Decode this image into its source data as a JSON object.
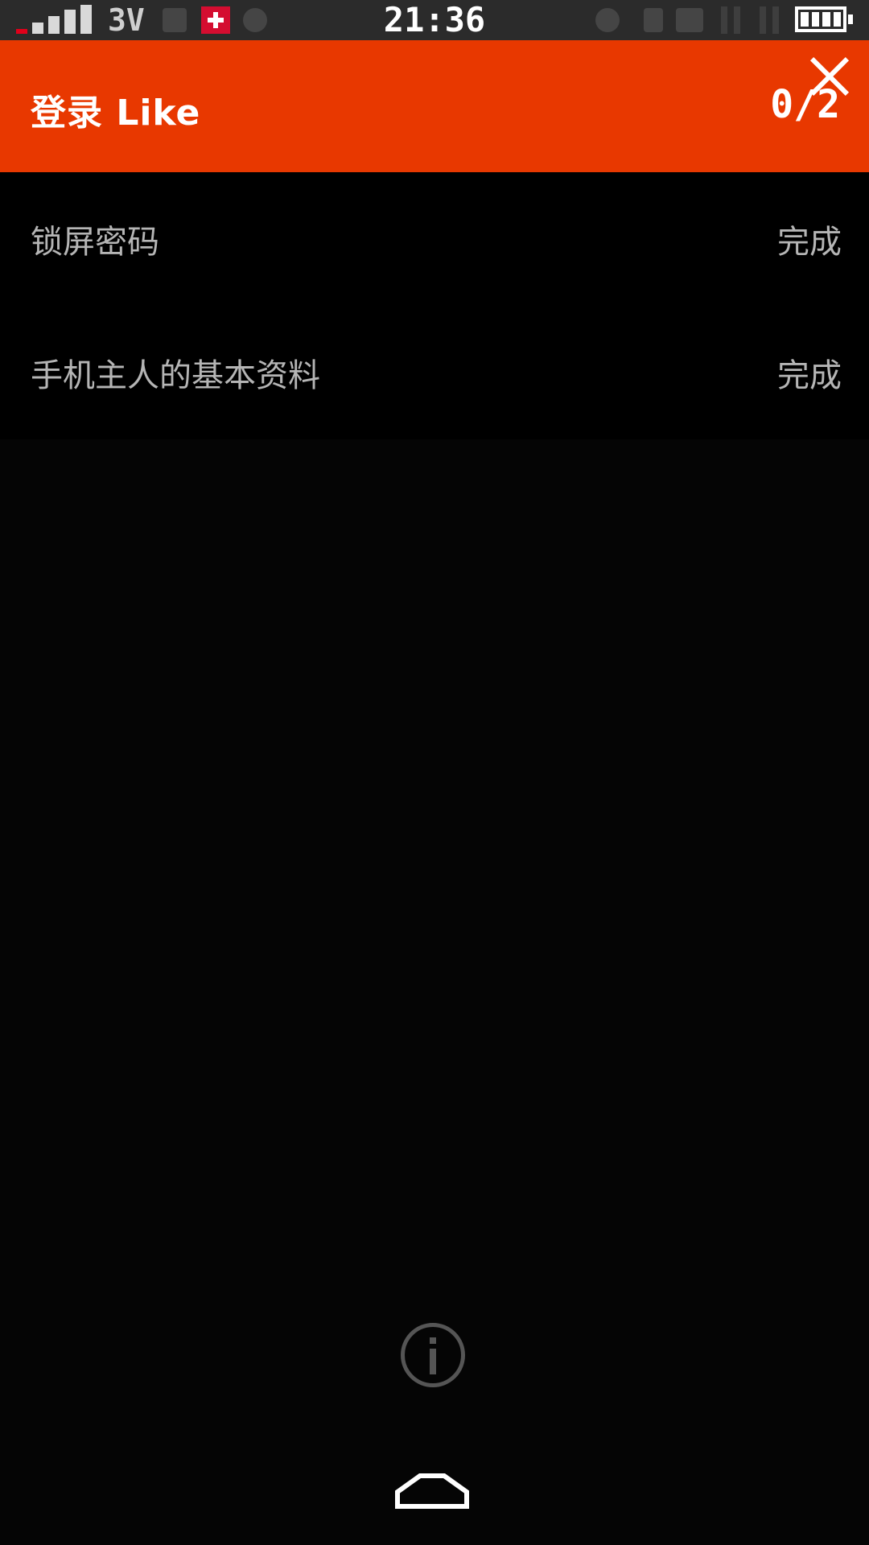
{
  "status_bar": {
    "network_label": "3V",
    "time": "21:36"
  },
  "header": {
    "title": "登录 Like",
    "progress": "0/2",
    "accent_color": "#e83800"
  },
  "steps": [
    {
      "label": "锁屏密码",
      "status": "完成"
    },
    {
      "label": "手机主人的基本资料",
      "status": "完成"
    }
  ],
  "icons": {
    "close": "close-icon",
    "info": "info-icon",
    "home": "home-icon"
  }
}
